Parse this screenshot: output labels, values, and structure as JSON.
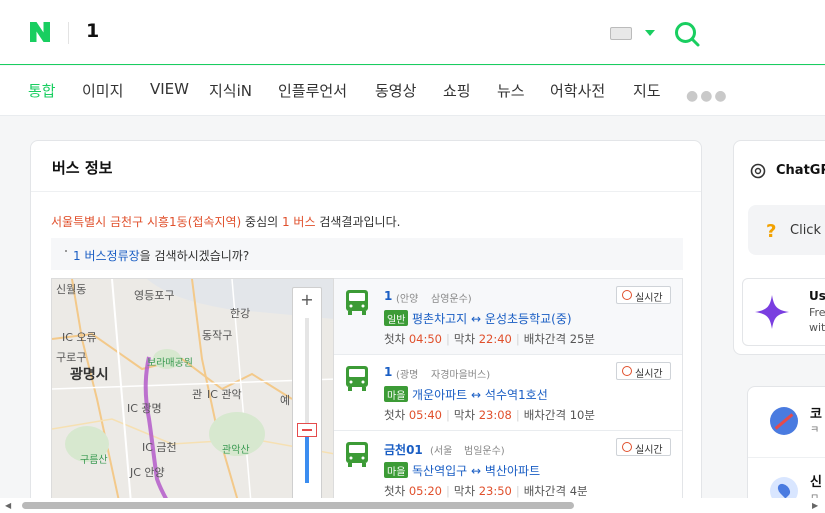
{
  "header": {
    "query": "1",
    "colors": {
      "brand": "#19ce60",
      "highlight": "#e0502c",
      "link": "#1a5ec4"
    },
    "icons": [
      "naver-logo-icon",
      "keyboard-icon",
      "chevron-down-icon",
      "search-icon"
    ]
  },
  "tabs": [
    "통합",
    "이미지",
    "VIEW",
    "지식iN",
    "인플루언서",
    "동영상",
    "쇼핑",
    "뉴스",
    "어학사전",
    "지도"
  ],
  "bus_panel": {
    "title": "버스 정보",
    "summary": {
      "location": "서울특별시 금천구 시흥1동(접속지역)",
      "middle": " 중심의 ",
      "keyword": "1 버스",
      "tail": " 검색결과입니다."
    },
    "hint": {
      "link": "1 버스정류장",
      "tail": "을 검색하시겠습니까?"
    },
    "map": {
      "labels": [
        "신월동",
        "영등포구",
        "동작구",
        "구로구",
        "광명시",
        "한강",
        "IC 오류",
        "IC 광명",
        "IC 금천",
        "IC 관악",
        "JC 안양",
        "구름산",
        "관악산",
        "보라매공원",
        "관",
        "예"
      ],
      "zoom_in": "+",
      "zoom_out": "−",
      "zoom_level_fraction": 0.32
    },
    "routes": [
      {
        "number": "1",
        "region": "(안양",
        "company": "삼영운수)",
        "badge": "일반",
        "from": "평촌차고지",
        "to": "운성초등학교(중)",
        "first_label": "첫차",
        "first": "04:50",
        "last_label": "막차",
        "last": "22:40",
        "interval": "배차간격 25분",
        "realtime": "실시간"
      },
      {
        "number": "1",
        "region": "(광명",
        "company": "자경마을버스)",
        "badge": "마을",
        "from": "개운아파트",
        "to": "석수역1호선",
        "first_label": "첫차",
        "first": "05:40",
        "last_label": "막차",
        "last": "23:08",
        "interval": "배차간격 10분",
        "realtime": "실시간"
      },
      {
        "number": "금천01",
        "region": "(서울",
        "company": "범일운수)",
        "badge": "마을",
        "from": "독산역입구",
        "to": "벽산아파트",
        "first_label": "첫차",
        "first": "05:20",
        "last_label": "막차",
        "last": "23:50",
        "interval": "배차간격 4분",
        "realtime": "실시간"
      }
    ],
    "arrow": "↔"
  },
  "sidebar": {
    "chatgpt_title": "ChatGPT",
    "click_text": "Click",
    "promo": {
      "line1": "Use",
      "line2": "Fre",
      "line3": "with"
    },
    "card2": {
      "t1": "코",
      "t2": "ㅋ",
      "t3": "신",
      "t4": "ㅁ"
    }
  },
  "scrollbar": {
    "left": "◀",
    "right": "▶"
  }
}
